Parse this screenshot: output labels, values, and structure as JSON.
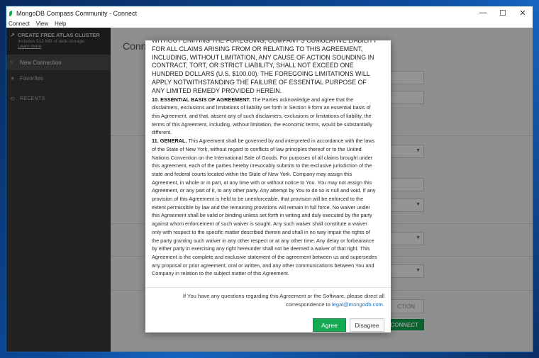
{
  "window": {
    "title": "MongoDB Compass Community - Connect",
    "controls": {
      "minimize": "—",
      "maximize": "☐",
      "close": "✕"
    }
  },
  "menu": [
    "Connect",
    "View",
    "Help"
  ],
  "sidebar": {
    "atlas": {
      "title": "CREATE FREE ATLAS CLUSTER",
      "subtitle": "Includes 512 MB of data storage.",
      "link": "Learn more"
    },
    "items": [
      {
        "label": "New Connection",
        "icon": "lightning-icon"
      },
      {
        "label": "Favorites",
        "icon": "star-icon"
      }
    ],
    "recents": {
      "label": "RECENTS",
      "icon": "history-icon"
    }
  },
  "main": {
    "title": "Conn",
    "favorite_button": "CTION",
    "connect_button": "CONNECT"
  },
  "dialog": {
    "upper_text": "WITHOUT LIMITING THE FOREGOING, COMPANY'S CUMULATIVE LIABILITY FOR ALL CLAIMS ARISING FROM OR RELATING TO THIS AGREEMENT, INCLUDING, WITHOUT LIMITATION, ANY CAUSE OF ACTION SOUNDING IN CONTRACT, TORT, OR STRICT LIABILITY, SHALL NOT EXCEED ONE HUNDRED DOLLARS (U.S. $100.00). THE FOREGOING LIMITATIONS WILL APPLY NOTWITHSTANDING THE FAILURE OF ESSENTIAL PURPOSE OF ANY LIMITED REMEDY PROVIDED HEREIN.",
    "section10": {
      "heading": "10. ESSENTIAL BASIS OF AGREEMENT.",
      "body": "The Parties acknowledge and agree that the disclaimers, exclusions and limitations of liability set forth in Section 9 form an essential basis of this Agreement, and that, absent any of such disclaimers, exclusions or limitations of liability, the terms of this Agreement, including, without limitation, the economic terms, would be substantially different."
    },
    "section11": {
      "heading": "11. GENERAL.",
      "body": "This Agreement shall be governed by and interpreted in accordance with the laws of the State of New York, without regard to conflicts of law principles thereof or to the United Nations Convention on the International Sale of Goods. For purposes of all claims brought under this agreement, each of the parties hereby irrevocably submits to the exclusive jurisdiction of the state and federal courts located within the State of New York. Company may assign this Agreement, in whole or in part, at any time with or without notice to You. You may not assign this Agreement, or any part of it, to any other party. Any attempt by You to do so is null and void. If any provision of this Agreement is held to be unenforceable, that provision will be enforced to the extent permissible by law and the remaining provisions will remain in full force. No waiver under this Agreement shall be valid or binding unless set forth in writing and duly executed by the party against whom enforcement of such waiver is sought. Any such waiver shall constitute a waiver only with respect to the specific matter described therein and shall in no way impair the rights of the party granting such waiver in any other respect or at any other time. Any delay or forbearance by either party in exercising any right hereunder shall not be deemed a waiver of that right. This Agreement is the complete and exclusive statement of the agreement between us and supersedes any proposal or prior agreement, oral or written, and any other communications between You and Company in relation to the subject matter of this Agreement."
    },
    "footer_text": "If You have any questions regarding this Agreement or the Software, please direct all correspondence to",
    "footer_email": "legal@mongodb.com",
    "footer_period": ".",
    "agree_label": "Agree",
    "disagree_label": "Disagree"
  }
}
